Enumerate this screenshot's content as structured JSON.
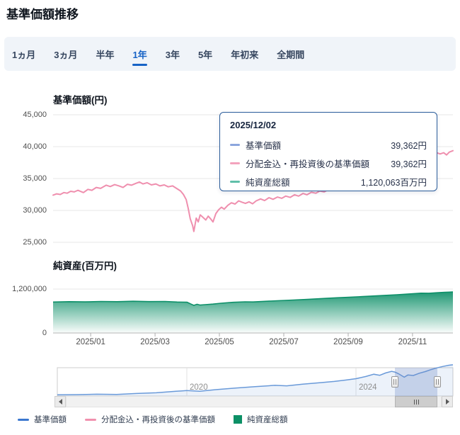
{
  "page_title": "基準価額推移",
  "tabs": {
    "items": [
      {
        "label": "1ヵ月",
        "active": false
      },
      {
        "label": "3ヵ月",
        "active": false
      },
      {
        "label": "半年",
        "active": false
      },
      {
        "label": "1年",
        "active": true
      },
      {
        "label": "3年",
        "active": false
      },
      {
        "label": "5年",
        "active": false
      },
      {
        "label": "年初来",
        "active": false
      },
      {
        "label": "全期間",
        "active": false
      }
    ]
  },
  "price_chart": {
    "title": "基準価額(円)"
  },
  "asset_chart": {
    "title": "純資産(百万円)"
  },
  "tooltip": {
    "date": "2025/12/02",
    "rows": [
      {
        "label": "基準価額",
        "value": "39,362円",
        "color": "#8ca6dd"
      },
      {
        "label": "分配金込・再投資後の基準価額",
        "value": "39,362円",
        "color": "#f3a3bd"
      },
      {
        "label": "純資産総額",
        "value": "1,120,063百万円",
        "color": "#5fbfa9"
      }
    ]
  },
  "legend": {
    "items": [
      {
        "label": "基準価額",
        "color": "#3b77cf",
        "type": "line"
      },
      {
        "label": "分配金込・再投資後の基準価額",
        "color": "#f191ae",
        "type": "line"
      },
      {
        "label": "純資産総額",
        "color": "#0c9066",
        "type": "square"
      }
    ]
  },
  "colors": {
    "accent_blue": "#1763c6",
    "price_line_pink": "#ef8fae",
    "asset_green": "#0e9069",
    "navigator_blue": "#6a9ad9",
    "mask_fill": "rgba(102,133,194,0.3)",
    "gridline": "#e7e7e7",
    "tooltip_border": "#2b5d9b"
  },
  "chart_data": [
    {
      "type": "line",
      "title": "基準価額(円)",
      "x_range": [
        "2024/12",
        "2025/12"
      ],
      "ylim": [
        25000,
        45000
      ],
      "yticks": [
        45000,
        40000,
        35000,
        30000,
        25000
      ],
      "ytick_labels": [
        "45,000",
        "40,000",
        "35,000",
        "30,000",
        "25,000"
      ],
      "grid": true,
      "series": [
        {
          "name": "基準価額",
          "color": "#3b77cf",
          "note": "coincides exactly with 分配金込・再投資後の基準価額 (hidden underneath)",
          "last_value": 39362
        },
        {
          "name": "分配金込・再投資後の基準価額",
          "color": "#ef8fae",
          "last_value": 39362,
          "points": [
            [
              0,
              32400
            ],
            [
              0.009,
              32600
            ],
            [
              0.018,
              32500
            ],
            [
              0.027,
              32800
            ],
            [
              0.035,
              32700
            ],
            [
              0.044,
              33000
            ],
            [
              0.053,
              32900
            ],
            [
              0.062,
              33150
            ],
            [
              0.076,
              32800
            ],
            [
              0.087,
              33300
            ],
            [
              0.097,
              33150
            ],
            [
              0.108,
              33600
            ],
            [
              0.119,
              33450
            ],
            [
              0.133,
              33950
            ],
            [
              0.143,
              33750
            ],
            [
              0.154,
              34050
            ],
            [
              0.165,
              33850
            ],
            [
              0.175,
              33600
            ],
            [
              0.186,
              34100
            ],
            [
              0.196,
              33950
            ],
            [
              0.207,
              34250
            ],
            [
              0.216,
              34450
            ],
            [
              0.225,
              34150
            ],
            [
              0.235,
              34350
            ],
            [
              0.246,
              34000
            ],
            [
              0.257,
              34150
            ],
            [
              0.267,
              33850
            ],
            [
              0.278,
              34000
            ],
            [
              0.288,
              33700
            ],
            [
              0.299,
              33850
            ],
            [
              0.31,
              33400
            ],
            [
              0.319,
              33050
            ],
            [
              0.326,
              32500
            ],
            [
              0.333,
              31700
            ],
            [
              0.338,
              30300
            ],
            [
              0.343,
              28700
            ],
            [
              0.349,
              27600
            ],
            [
              0.352,
              26700
            ],
            [
              0.358,
              28800
            ],
            [
              0.363,
              28200
            ],
            [
              0.368,
              29300
            ],
            [
              0.375,
              28900
            ],
            [
              0.382,
              28500
            ],
            [
              0.388,
              29100
            ],
            [
              0.395,
              28600
            ],
            [
              0.4,
              28200
            ],
            [
              0.407,
              29500
            ],
            [
              0.414,
              30100
            ],
            [
              0.421,
              30500
            ],
            [
              0.428,
              30200
            ],
            [
              0.437,
              30800
            ],
            [
              0.446,
              31200
            ],
            [
              0.455,
              31000
            ],
            [
              0.464,
              31500
            ],
            [
              0.472,
              31300
            ],
            [
              0.481,
              31100
            ],
            [
              0.49,
              31350
            ],
            [
              0.499,
              31050
            ],
            [
              0.508,
              31500
            ],
            [
              0.519,
              31800
            ],
            [
              0.529,
              31550
            ],
            [
              0.54,
              32000
            ],
            [
              0.55,
              31750
            ],
            [
              0.561,
              32100
            ],
            [
              0.572,
              31900
            ],
            [
              0.582,
              32250
            ],
            [
              0.593,
              32050
            ],
            [
              0.604,
              32450
            ],
            [
              0.614,
              32250
            ],
            [
              0.625,
              32650
            ],
            [
              0.635,
              32450
            ],
            [
              0.646,
              32850
            ],
            [
              0.657,
              32700
            ],
            [
              0.667,
              33050
            ],
            [
              0.678,
              32900
            ],
            [
              0.688,
              33250
            ],
            [
              0.699,
              33550
            ],
            [
              0.713,
              34000
            ],
            [
              0.727,
              34450
            ],
            [
              0.742,
              34900
            ],
            [
              0.756,
              35400
            ],
            [
              0.77,
              35850
            ],
            [
              0.784,
              36350
            ],
            [
              0.798,
              36800
            ],
            [
              0.812,
              37200
            ],
            [
              0.826,
              37650
            ],
            [
              0.841,
              38050
            ],
            [
              0.855,
              38400
            ],
            [
              0.869,
              38750
            ],
            [
              0.883,
              39050
            ],
            [
              0.894,
              39250
            ],
            [
              0.904,
              39000
            ],
            [
              0.915,
              39200
            ],
            [
              0.925,
              38850
            ],
            [
              0.936,
              39050
            ],
            [
              0.947,
              38800
            ],
            [
              0.957,
              39100
            ],
            [
              0.968,
              38850
            ],
            [
              0.977,
              39050
            ],
            [
              0.984,
              38700
            ],
            [
              0.991,
              39150
            ],
            [
              1,
              39362
            ]
          ]
        }
      ]
    },
    {
      "type": "area",
      "title": "純資産(百万円)",
      "x_range": [
        "2024/12",
        "2025/12"
      ],
      "ylim": [
        0,
        1200000
      ],
      "yticks": [
        1200000,
        0
      ],
      "ytick_labels": [
        "1,200,000",
        "0"
      ],
      "xticks": [
        {
          "label": "2025/01",
          "frac": 0.094
        },
        {
          "label": "2025/03",
          "frac": 0.255
        },
        {
          "label": "2025/05",
          "frac": 0.416
        },
        {
          "label": "2025/07",
          "frac": 0.577
        },
        {
          "label": "2025/09",
          "frac": 0.738
        },
        {
          "label": "2025/11",
          "frac": 0.899
        }
      ],
      "series": [
        {
          "name": "純資産総額",
          "color": "#0e9069",
          "last_value": 1120063,
          "points": [
            [
              0,
              845000
            ],
            [
              0.04,
              855000
            ],
            [
              0.08,
              850000
            ],
            [
              0.12,
              862000
            ],
            [
              0.16,
              855000
            ],
            [
              0.2,
              868000
            ],
            [
              0.24,
              858000
            ],
            [
              0.28,
              862000
            ],
            [
              0.31,
              845000
            ],
            [
              0.335,
              840000
            ],
            [
              0.345,
              790000
            ],
            [
              0.352,
              755000
            ],
            [
              0.36,
              785000
            ],
            [
              0.368,
              762000
            ],
            [
              0.38,
              775000
            ],
            [
              0.4,
              790000
            ],
            [
              0.42,
              812000
            ],
            [
              0.45,
              838000
            ],
            [
              0.48,
              852000
            ],
            [
              0.5,
              848000
            ],
            [
              0.53,
              865000
            ],
            [
              0.56,
              880000
            ],
            [
              0.6,
              900000
            ],
            [
              0.64,
              922000
            ],
            [
              0.68,
              945000
            ],
            [
              0.71,
              962000
            ],
            [
              0.74,
              975000
            ],
            [
              0.77,
              992000
            ],
            [
              0.8,
              1010000
            ],
            [
              0.83,
              1028000
            ],
            [
              0.86,
              1045000
            ],
            [
              0.88,
              1058000
            ],
            [
              0.9,
              1075000
            ],
            [
              0.92,
              1088000
            ],
            [
              0.94,
              1085000
            ],
            [
              0.96,
              1100000
            ],
            [
              0.98,
              1112000
            ],
            [
              1,
              1120063
            ]
          ]
        }
      ]
    },
    {
      "type": "line",
      "title": "navigator (基準価額 全期間 ~2017-2025)",
      "ylim": [
        9000,
        40000
      ],
      "x_gridlines": [
        {
          "label": "2020",
          "frac": 0.3274
        },
        {
          "label": "2024",
          "frac": 0.7549
        }
      ],
      "selection": {
        "start_frac": 0.8533,
        "end_frac": 0.9606
      },
      "series": [
        {
          "name": "基準価額",
          "color": "#6a9ad9",
          "points": [
            [
              0,
              10200
            ],
            [
              0.05,
              10400
            ],
            [
              0.1,
              10800
            ],
            [
              0.15,
              10600
            ],
            [
              0.2,
              11500
            ],
            [
              0.25,
              12200
            ],
            [
              0.3,
              13600
            ],
            [
              0.327,
              14300
            ],
            [
              0.36,
              13600
            ],
            [
              0.4,
              15200
            ],
            [
              0.45,
              16800
            ],
            [
              0.5,
              18200
            ],
            [
              0.55,
              19400
            ],
            [
              0.58,
              18900
            ],
            [
              0.62,
              20500
            ],
            [
              0.66,
              21800
            ],
            [
              0.7,
              23200
            ],
            [
              0.73,
              24600
            ],
            [
              0.755,
              25900
            ],
            [
              0.78,
              28000
            ],
            [
              0.8,
              30200
            ],
            [
              0.815,
              29200
            ],
            [
              0.83,
              31500
            ],
            [
              0.845,
              33000
            ],
            [
              0.853,
              32400
            ],
            [
              0.862,
              30800
            ],
            [
              0.877,
              27300
            ],
            [
              0.886,
              29500
            ],
            [
              0.9,
              29000
            ],
            [
              0.915,
              31200
            ],
            [
              0.93,
              32800
            ],
            [
              0.945,
              34800
            ],
            [
              0.96,
              36400
            ],
            [
              0.975,
              37800
            ],
            [
              0.99,
              39000
            ],
            [
              1,
              39362
            ]
          ]
        }
      ]
    }
  ]
}
